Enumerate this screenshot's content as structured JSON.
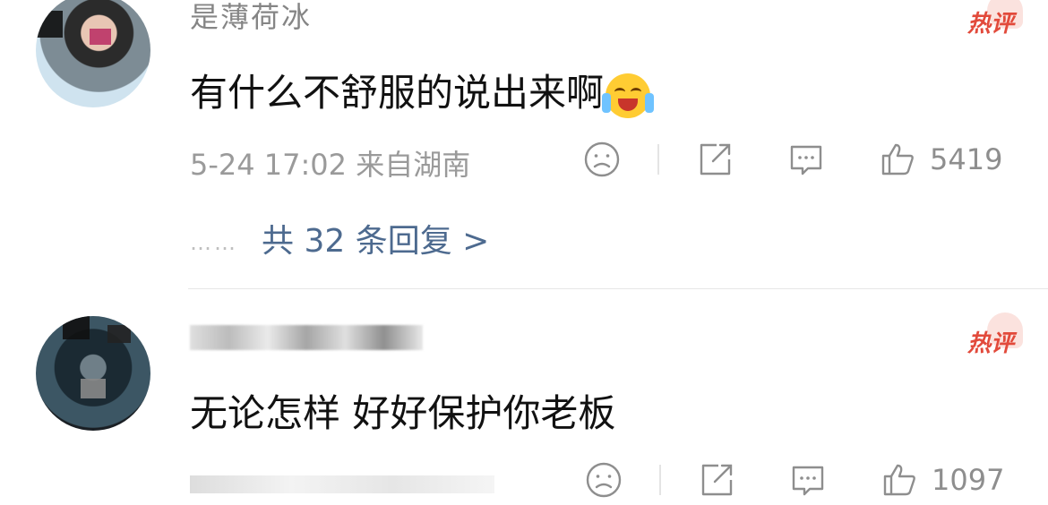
{
  "comments": [
    {
      "username": "是薄荷冰",
      "badge": "热评",
      "text": "有什么不舒服的说出来啊",
      "emoji": "crying-laughing-emoji",
      "meta": "5-24 17:02  来自湖南",
      "likes": "5419",
      "replies_label": "共 32 条回复 >",
      "replies_dots": "……"
    },
    {
      "username": "",
      "badge": "热评",
      "text": "无论怎样 好好保护你老板",
      "meta": "",
      "likes": "1097"
    }
  ],
  "colors": {
    "hot": "#e24a3b",
    "link": "#4d6a8f",
    "meta": "#9a9a9a",
    "text": "#111111"
  },
  "icons": [
    "sad-face-icon",
    "share-icon",
    "comment-icon",
    "thumbs-up-icon"
  ]
}
